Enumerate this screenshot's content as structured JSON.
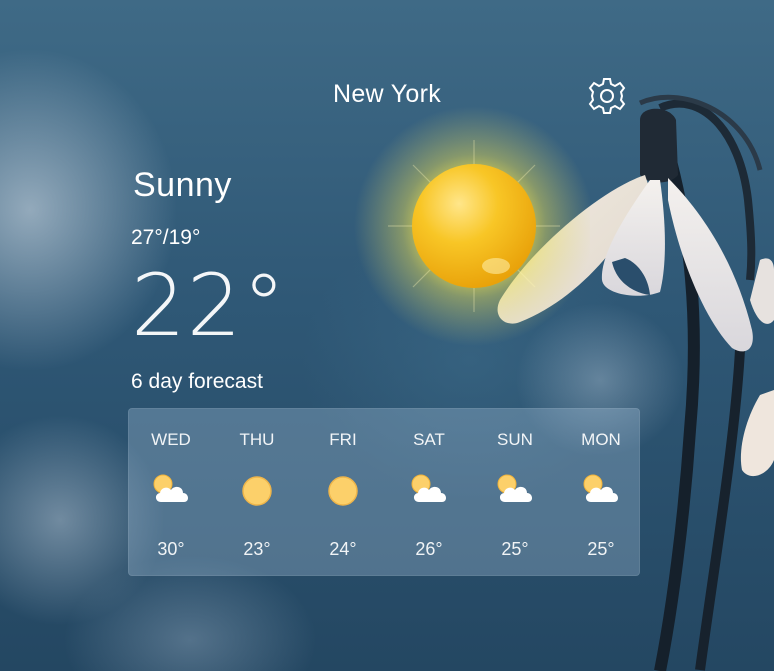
{
  "location": {
    "city": "New York"
  },
  "current": {
    "condition": "Sunny",
    "high_low": "27°/19°",
    "temperature": "22°",
    "icon": "sun-icon"
  },
  "forecast": {
    "title": "6 day forecast",
    "days": [
      {
        "day": "WED",
        "icon": "partly-cloudy-icon",
        "temp": "30°"
      },
      {
        "day": "THU",
        "icon": "sun-icon",
        "temp": "23°"
      },
      {
        "day": "FRI",
        "icon": "sun-icon",
        "temp": "24°"
      },
      {
        "day": "SAT",
        "icon": "partly-cloudy-icon",
        "temp": "26°"
      },
      {
        "day": "SUN",
        "icon": "partly-cloudy-icon",
        "temp": "25°"
      },
      {
        "day": "MON",
        "icon": "partly-cloudy-icon",
        "temp": "25°"
      }
    ]
  },
  "toolbar": {
    "settings_icon": "gear-icon"
  },
  "colors": {
    "sun_core": "#f7c21c",
    "sun_glow": "#f3e14a",
    "small_sun": "#fcd06a",
    "cloud": "#ffffff",
    "panel": "#aac8e1"
  }
}
